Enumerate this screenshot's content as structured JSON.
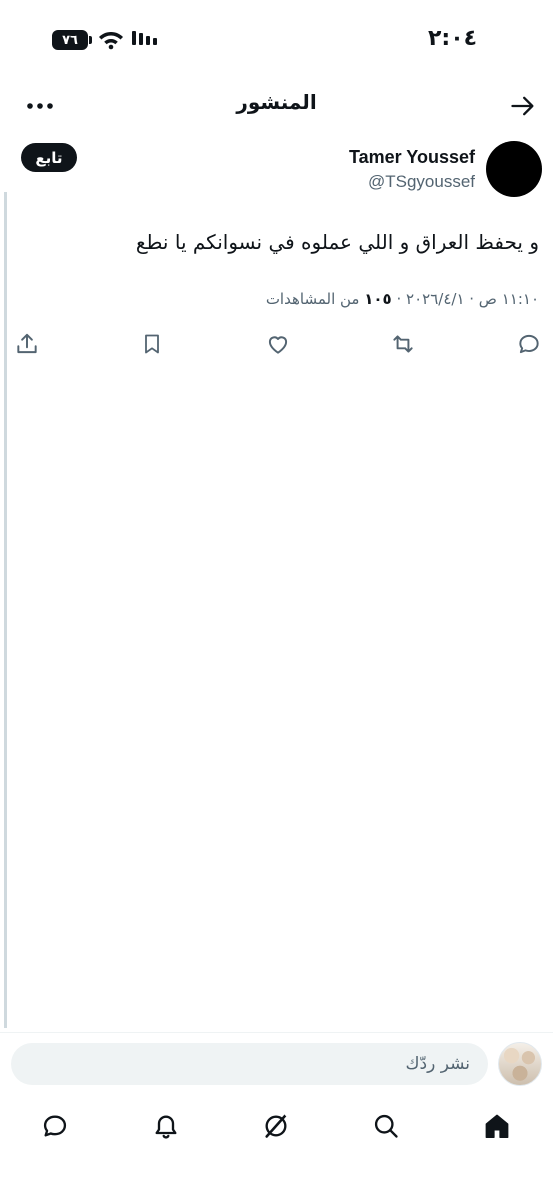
{
  "status_bar": {
    "time": "٢:٠٤",
    "battery": "٧٦"
  },
  "header": {
    "title": "المنشور"
  },
  "post": {
    "display_name": "Tamer Youssef",
    "handle": "@TSgyoussef",
    "follow_label": "تابع",
    "text": "و يحفظ العراق و اللي عملوه في نسوانكم يا نطع",
    "timestamp": "١١:١٠ ص · ٢٠٢٦/٤/١",
    "views_count": "١٠٥",
    "views_label": "من المشاهدات"
  },
  "reply": {
    "placeholder": "نشر ردّك"
  },
  "icons": {
    "actions": [
      "reply-icon",
      "retweet-icon",
      "like-icon",
      "bookmark-icon",
      "share-icon"
    ],
    "nav": [
      "home-icon",
      "search-icon",
      "grok-icon",
      "notifications-icon",
      "messages-icon"
    ]
  }
}
